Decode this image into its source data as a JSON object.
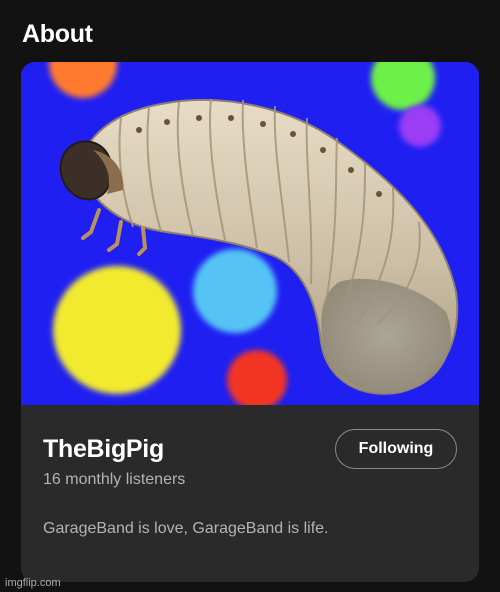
{
  "section": {
    "title": "About"
  },
  "artist": {
    "name": "TheBigPig",
    "monthly_listeners": "16 monthly listeners",
    "bio": "GarageBand is love, GarageBand is life.",
    "follow_button_label": "Following",
    "image_subject": "grub-on-polka-dot-background"
  },
  "watermark": {
    "text": "imgflip.com"
  },
  "colors": {
    "page_background": "#121212",
    "card_background": "#2a2a2a",
    "image_background": "#1f1ff2",
    "secondary_text": "#b3b3b3"
  }
}
